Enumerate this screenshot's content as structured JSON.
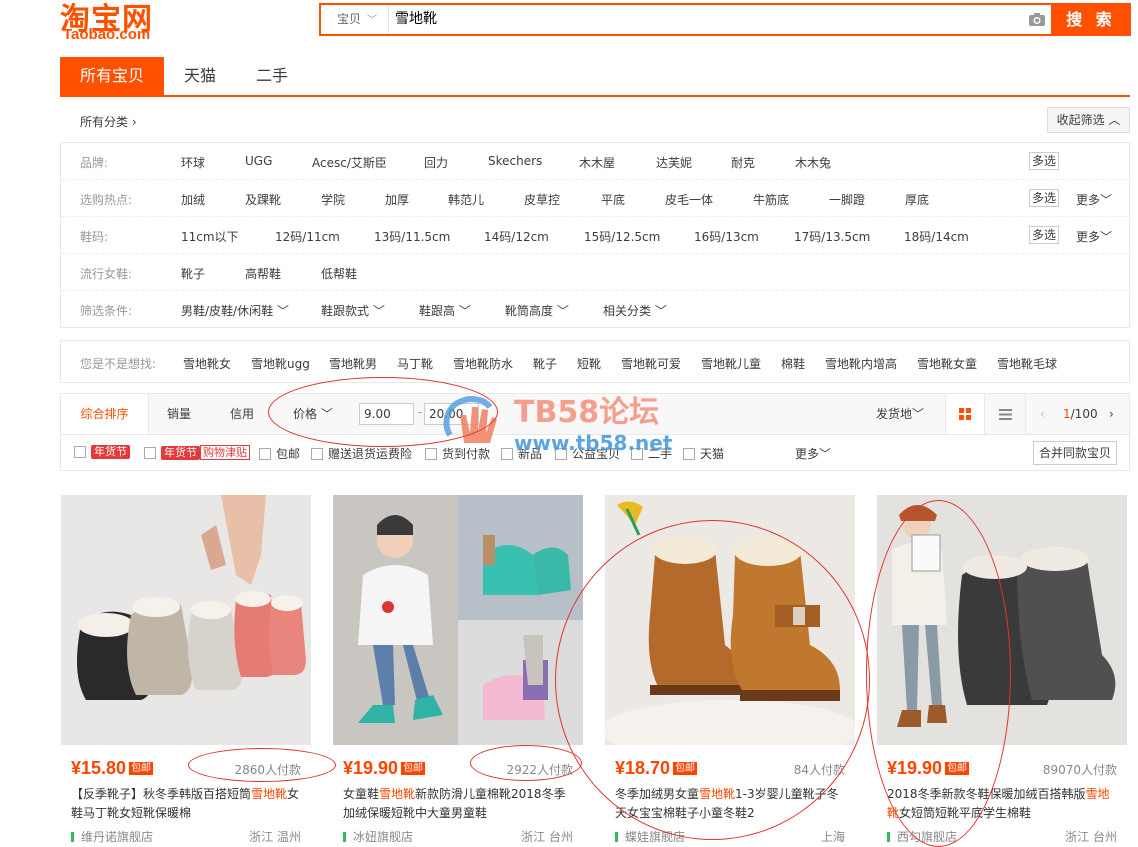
{
  "header": {
    "logo_cn": "淘宝网",
    "logo_en": "Taobao.com",
    "search_category": "宝贝",
    "search_query": "雪地靴",
    "search_button": "搜 索"
  },
  "tabs": [
    "所有宝贝",
    "天猫",
    "二手"
  ],
  "breadcrumb": "所有分类",
  "collapse_label": "收起筛选",
  "filters": {
    "brand_label": "品牌:",
    "brands": [
      "环球",
      "UGG",
      "Acesc/艾斯臣",
      "回力",
      "Skechers",
      "木木屋",
      "达芙妮",
      "耐克",
      "木木兔"
    ],
    "hot_label": "选购热点:",
    "hot": [
      "加绒",
      "及踝靴",
      "学院",
      "加厚",
      "韩范儿",
      "皮草控",
      "平底",
      "皮毛一体",
      "牛筋底",
      "一脚蹬",
      "厚底"
    ],
    "size_label": "鞋码:",
    "sizes": [
      "11cm以下",
      "12码/11cm",
      "13码/11.5cm",
      "14码/12cm",
      "15码/12.5cm",
      "16码/13cm",
      "17码/13.5cm",
      "18码/14cm"
    ],
    "style_label": "流行女鞋:",
    "styles": [
      "靴子",
      "高帮鞋",
      "低帮鞋"
    ],
    "cond_label": "筛选条件:",
    "conds": [
      "男鞋/皮鞋/休闲鞋",
      "鞋跟款式",
      "鞋跟高",
      "靴筒高度",
      "相关分类"
    ],
    "multi": "多选",
    "more": "更多"
  },
  "suggest": {
    "label": "您是不是想找:",
    "items": [
      "雪地靴女",
      "雪地靴ugg",
      "雪地靴男",
      "马丁靴",
      "雪地靴防水",
      "靴子",
      "短靴",
      "雪地靴可爱",
      "雪地靴儿童",
      "棉鞋",
      "雪地靴内增高",
      "雪地靴女童",
      "雪地靴毛球"
    ]
  },
  "sort": {
    "items": [
      "综合排序",
      "销量",
      "信用",
      "价格"
    ],
    "price_min": "9.00",
    "price_max": "20.00",
    "ship_from": "发货地",
    "page": "1",
    "total": "/100"
  },
  "checks": {
    "items": [
      "年货节",
      "年货节",
      "购物津贴",
      "包邮",
      "赠送退货运费险",
      "货到付款",
      "新品",
      "公益宝贝",
      "二手",
      "天猫"
    ],
    "more": "更多",
    "merge": "合并同款宝贝"
  },
  "watermark": {
    "title": "TB58论坛",
    "url": "www.tb58.net"
  },
  "products": [
    {
      "price": "¥15.80",
      "baoyou": "包邮",
      "sold": "2860人付款",
      "title_pre": "【反季靴子】秋冬季韩版百搭短筒",
      "title_hl": "雪地靴",
      "title_post": "女鞋马丁靴女短靴保暖棉",
      "shop": "维丹诺旗舰店",
      "loc": "浙江 温州"
    },
    {
      "price": "¥19.90",
      "baoyou": "包邮",
      "sold": "2922人付款",
      "title_pre": "女童鞋",
      "title_hl": "雪地靴",
      "title_post": "新款防滑儿童棉靴2018冬季加绒保暖短靴中大童男童鞋",
      "shop": "冰妞旗舰店",
      "loc": "浙江 台州"
    },
    {
      "price": "¥18.70",
      "baoyou": "包邮",
      "sold": "84人付款",
      "title_pre": "冬季加绒男女童",
      "title_hl": "雪地靴",
      "title_post": "1-3岁婴儿童靴子冬天女宝宝棉鞋子小童冬鞋2",
      "shop": "蝶娃旗舰店",
      "loc": "上海"
    },
    {
      "price": "¥19.90",
      "baoyou": "包邮",
      "sold": "89070人付款",
      "title_pre": "2018冬季新款冬鞋保暖加绒百搭韩版",
      "title_hl": "雪地靴",
      "title_post": "女短筒短靴平底学生棉鞋",
      "shop": "西勾旗舰店",
      "loc": "浙江 台州"
    }
  ]
}
